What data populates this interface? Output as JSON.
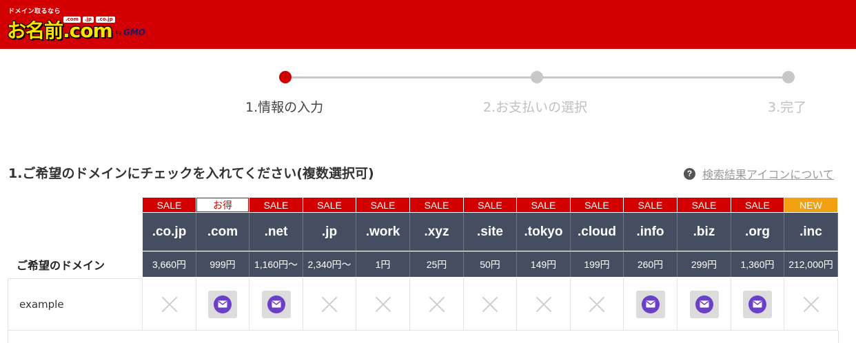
{
  "header": {
    "tagline": "ドメイン取るなら",
    "tlds": [
      ".com",
      ".jp",
      ".co.jp"
    ],
    "brand": "お名前.com",
    "by": "by",
    "gmo": "GMO"
  },
  "steps": [
    {
      "label": "1.情報の入力",
      "active": true
    },
    {
      "label": "2.お支払いの選択",
      "active": false
    },
    {
      "label": "3.完了",
      "active": false
    }
  ],
  "section_title": "1.ご希望のドメインにチェックを入れてください(複数選択可)",
  "help_link": "検索結果アイコンについて",
  "row_label": "ご希望のドメイン",
  "domains": [
    {
      "badge": "SALE",
      "badge_type": "sale",
      "tld": ".co.jp",
      "price": "3,660円",
      "available": false
    },
    {
      "badge": "お得",
      "badge_type": "otoku",
      "tld": ".com",
      "price": "999円",
      "available": true
    },
    {
      "badge": "SALE",
      "badge_type": "sale",
      "tld": ".net",
      "price": "1,160円〜",
      "available": true
    },
    {
      "badge": "SALE",
      "badge_type": "sale",
      "tld": ".jp",
      "price": "2,340円〜",
      "available": false
    },
    {
      "badge": "SALE",
      "badge_type": "sale",
      "tld": ".work",
      "price": "1円",
      "available": false
    },
    {
      "badge": "SALE",
      "badge_type": "sale",
      "tld": ".xyz",
      "price": "25円",
      "available": false
    },
    {
      "badge": "SALE",
      "badge_type": "sale",
      "tld": ".site",
      "price": "50円",
      "available": false
    },
    {
      "badge": "SALE",
      "badge_type": "sale",
      "tld": ".tokyo",
      "price": "149円",
      "available": false
    },
    {
      "badge": "SALE",
      "badge_type": "sale",
      "tld": ".cloud",
      "price": "199円",
      "available": false
    },
    {
      "badge": "SALE",
      "badge_type": "sale",
      "tld": ".info",
      "price": "260円",
      "available": true
    },
    {
      "badge": "SALE",
      "badge_type": "sale",
      "tld": ".biz",
      "price": "299円",
      "available": true
    },
    {
      "badge": "SALE",
      "badge_type": "sale",
      "tld": ".org",
      "price": "1,360円",
      "available": true
    },
    {
      "badge": "NEW",
      "badge_type": "new",
      "tld": ".inc",
      "price": "212,000円",
      "available": false
    }
  ],
  "search_term": "example",
  "colors": {
    "header_red": "#d20000",
    "step_active": "#cc0000",
    "tld_bg": "#454e60",
    "new_badge": "#f0a010",
    "mail_purple": "#6c3fc9"
  }
}
